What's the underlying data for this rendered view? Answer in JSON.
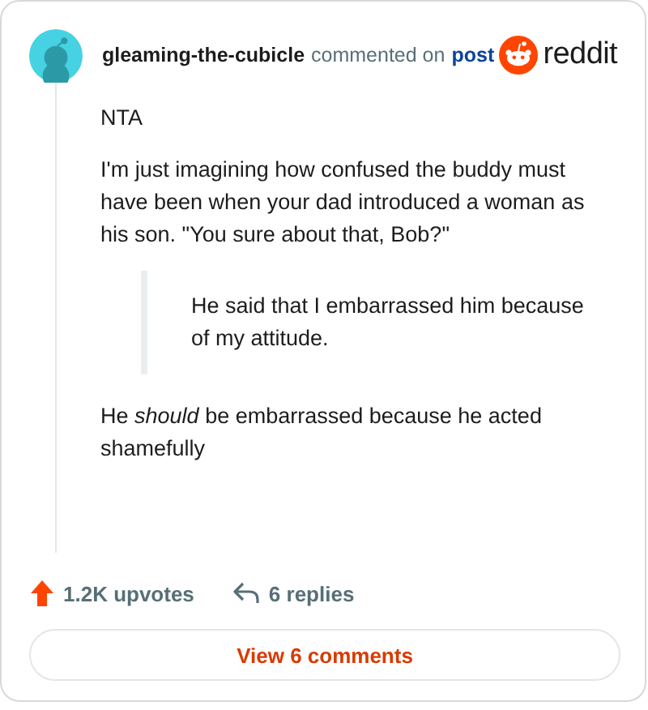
{
  "header": {
    "username": "gleaming-the-cubicle",
    "action": "commented on",
    "link": "post",
    "brand": "reddit"
  },
  "body": [
    {
      "kind": "paragraph",
      "text": "NTA"
    },
    {
      "kind": "paragraph",
      "text": "I'm just imagining how confused the buddy must have been when your dad introduced a woman as his son. \"You sure about that, Bob?\""
    },
    {
      "kind": "quote",
      "text": "He said that I embarrassed him because of my attitude."
    },
    {
      "kind": "paragraph",
      "text": "He *should* be embarrassed because he acted shamefully"
    }
  ],
  "footer": {
    "upvotes": "1.2K upvotes",
    "replies": "6 replies"
  },
  "button": "View 6 comments"
}
